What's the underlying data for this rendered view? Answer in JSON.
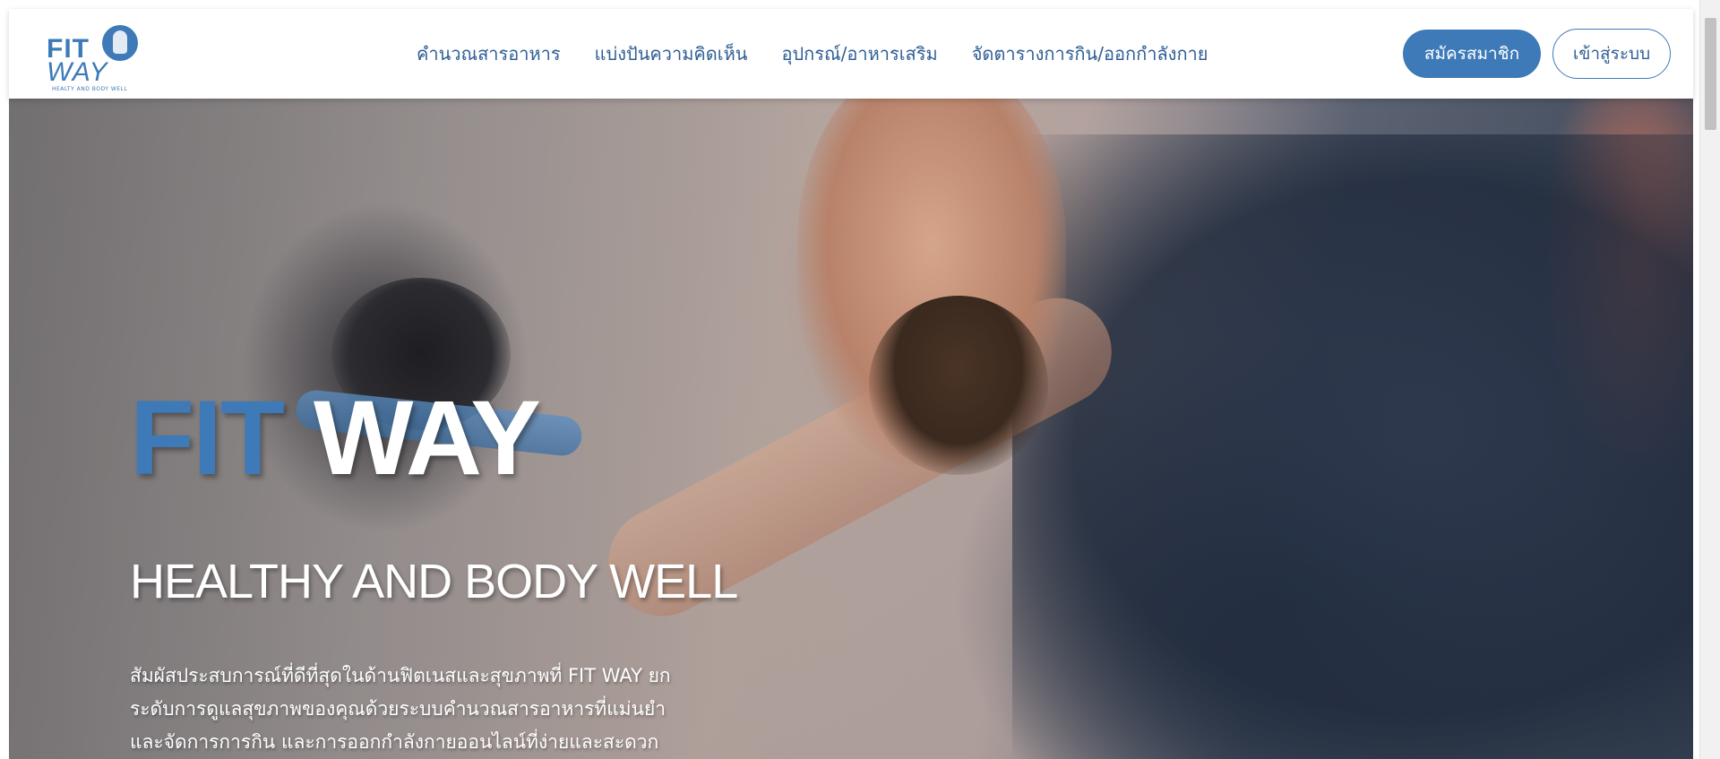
{
  "logo": {
    "line1": "FIT",
    "line2": "WAY",
    "sub": "HEALTY AND BODY WELL"
  },
  "nav": {
    "links": [
      "คำนวณสารอาหาร",
      "แบ่งปันความคิดเห็น",
      "อุปกรณ์/อาหารเสริม",
      "จัดตารางการกิน/ออกกำลังกาย"
    ],
    "register_label": "สมัครสมาชิก",
    "login_label": "เข้าสู่ระบบ"
  },
  "hero": {
    "title_fit": "FIT",
    "title_way": "WAY",
    "tagline": "HEALTHY AND BODY WELL",
    "description_lines": [
      "สัมผัสประสบการณ์ที่ดีที่สุดในด้านฟิตเนสและสุขภาพที่ FIT WAY ยก",
      "ระดับการดูแลสุขภาพของคุณด้วยระบบคำนวณสารอาหารที่แม่นยำ",
      "และจัดการการกิน และการออกกำลังกายออนไลน์ที่ง่ายและสะดวก"
    ]
  },
  "colors": {
    "brand_blue": "#3d7ab7",
    "nav_text": "#2f5e95",
    "white": "#ffffff"
  }
}
